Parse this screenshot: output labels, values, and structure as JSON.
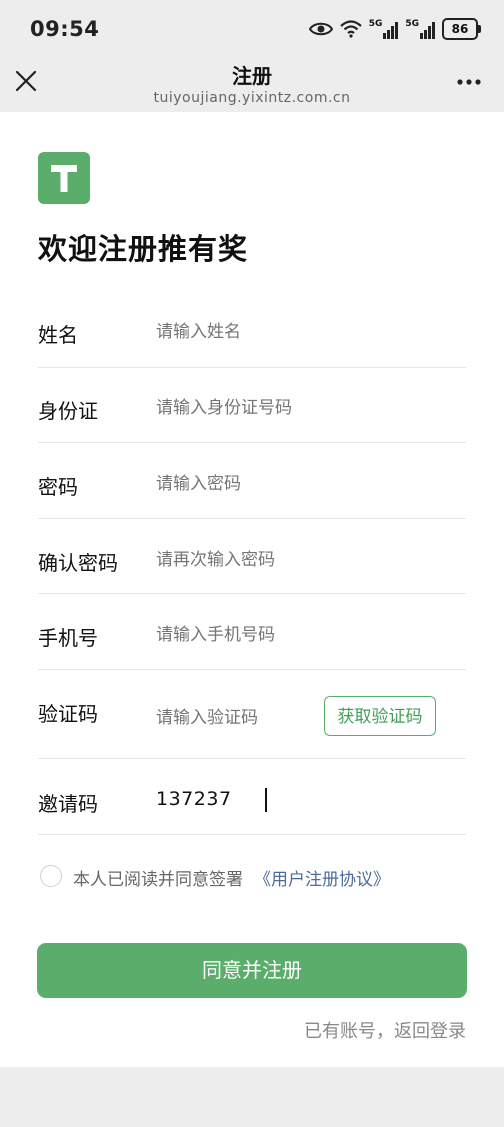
{
  "status_bar": {
    "time": "09:54",
    "icons": [
      "eye-icon",
      "wifi-icon",
      "signal-5g-icon",
      "signal-5g-icon"
    ],
    "signal_label": "5G",
    "battery": "86"
  },
  "nav": {
    "title": "注册",
    "url": "tuiyoujiang.yixintz.com.cn",
    "close_icon": "close-icon",
    "more_icon": "more-icon"
  },
  "logo": {
    "letter": "T",
    "color": "#5aad6b"
  },
  "heading": "欢迎注册推有奖",
  "form": {
    "name": {
      "label": "姓名",
      "placeholder": "请输入姓名"
    },
    "id_card": {
      "label": "身份证",
      "placeholder": "请输入身份证号码"
    },
    "password": {
      "label": "密码",
      "placeholder": "请输入密码"
    },
    "confirm_password": {
      "label": "确认密码",
      "placeholder": "请再次输入密码"
    },
    "phone": {
      "label": "手机号",
      "placeholder": "请输入手机号码"
    },
    "verify_code": {
      "label": "验证码",
      "placeholder": "请输入验证码",
      "button": "获取验证码"
    },
    "invite_code": {
      "label": "邀请码",
      "value": "137237"
    }
  },
  "agreement": {
    "text": "本人已阅读并同意签署",
    "link": "《用户注册协议》"
  },
  "submit_label": "同意并注册",
  "login_link": "已有账号，返回登录",
  "colors": {
    "accent": "#5aad6b",
    "link": "#4a6c9c"
  }
}
